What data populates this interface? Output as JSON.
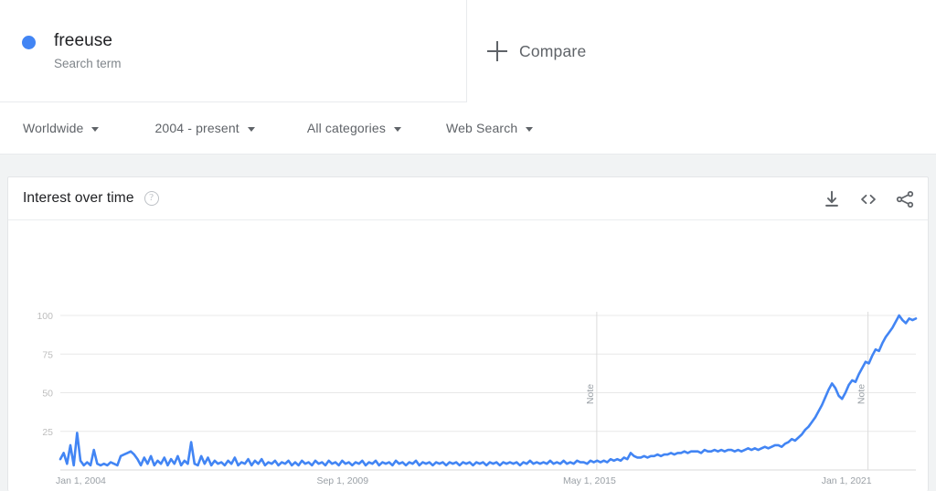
{
  "search_row": {
    "term": "freeuse",
    "subtitle": "Search term",
    "dot_color": "#4285f4",
    "compare_label": "Compare",
    "plus_icon": "plus-icon"
  },
  "filters": [
    {
      "label": "Worldwide",
      "name": "region"
    },
    {
      "label": "2004 - present",
      "name": "time-range"
    },
    {
      "label": "All categories",
      "name": "category"
    },
    {
      "label": "Web Search",
      "name": "search-type"
    }
  ],
  "card": {
    "title": "Interest over time",
    "help_icon": "?",
    "actions": [
      {
        "name": "download-icon"
      },
      {
        "name": "embed-icon"
      },
      {
        "name": "share-icon"
      }
    ]
  },
  "chart_data": {
    "type": "line",
    "title": "Interest over time",
    "xlabel": "",
    "ylabel": "",
    "ylim": [
      0,
      100
    ],
    "grid": true,
    "legend": false,
    "line_color": "#4285f4",
    "yticks": [
      100,
      75,
      50,
      25
    ],
    "xticks": [
      "Jan 1, 2004",
      "Sep 1, 2009",
      "May 1, 2015",
      "Jan 1, 2021"
    ],
    "xtick_positions": [
      0.0,
      0.305,
      0.593,
      0.895
    ],
    "annotations": [
      {
        "label": "Note",
        "position": 0.627
      },
      {
        "label": "Note",
        "position": 0.944
      }
    ],
    "series": [
      {
        "name": "freeuse",
        "values": [
          7,
          11,
          4,
          16,
          3,
          24,
          6,
          3,
          5,
          3,
          13,
          4,
          3,
          4,
          3,
          5,
          4,
          3,
          9,
          10,
          11,
          12,
          10,
          7,
          3,
          8,
          4,
          9,
          3,
          6,
          4,
          8,
          3,
          7,
          4,
          9,
          3,
          6,
          4,
          18,
          4,
          3,
          9,
          4,
          8,
          3,
          6,
          4,
          5,
          3,
          6,
          4,
          8,
          3,
          5,
          4,
          7,
          3,
          6,
          4,
          7,
          3,
          5,
          4,
          6,
          3,
          5,
          4,
          6,
          3,
          5,
          3,
          6,
          4,
          5,
          3,
          6,
          4,
          5,
          3,
          6,
          4,
          5,
          3,
          6,
          4,
          5,
          3,
          5,
          4,
          6,
          3,
          5,
          4,
          6,
          3,
          5,
          4,
          5,
          3,
          6,
          4,
          5,
          3,
          5,
          4,
          6,
          3,
          5,
          4,
          5,
          3,
          5,
          4,
          5,
          3,
          5,
          4,
          5,
          3,
          5,
          4,
          5,
          3,
          5,
          4,
          5,
          3,
          5,
          4,
          5,
          3,
          5,
          4,
          5,
          4,
          5,
          3,
          5,
          4,
          6,
          4,
          5,
          4,
          5,
          4,
          6,
          4,
          5,
          4,
          6,
          4,
          5,
          4,
          6,
          5,
          5,
          4,
          6,
          5,
          6,
          5,
          6,
          5,
          7,
          6,
          7,
          6,
          8,
          7,
          11,
          9,
          8,
          8,
          9,
          8,
          9,
          9,
          10,
          9,
          10,
          10,
          11,
          10,
          11,
          11,
          12,
          11,
          12,
          12,
          12,
          11,
          13,
          12,
          12,
          13,
          12,
          13,
          12,
          13,
          13,
          12,
          13,
          12,
          13,
          14,
          13,
          14,
          13,
          14,
          15,
          14,
          15,
          16,
          16,
          15,
          17,
          18,
          20,
          19,
          21,
          23,
          26,
          28,
          31,
          34,
          38,
          42,
          47,
          52,
          56,
          53,
          48,
          46,
          50,
          55,
          58,
          57,
          62,
          66,
          70,
          69,
          74,
          78,
          77,
          82,
          86,
          89,
          92,
          96,
          100,
          97,
          95,
          98,
          97,
          98
        ]
      }
    ]
  }
}
